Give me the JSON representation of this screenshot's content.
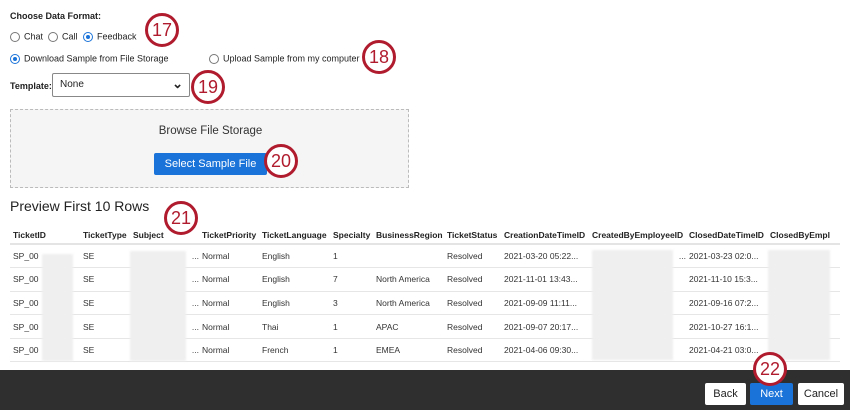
{
  "data_format": {
    "label": "Choose Data Format:",
    "options": [
      {
        "label": "Chat",
        "selected": false
      },
      {
        "label": "Call",
        "selected": false
      },
      {
        "label": "Feedback",
        "selected": true
      }
    ]
  },
  "source": {
    "options": [
      {
        "label": "Download Sample from File Storage",
        "selected": true
      },
      {
        "label": "Upload Sample from my computer",
        "selected": false
      }
    ]
  },
  "template": {
    "label": "Template:",
    "value": "None"
  },
  "browse": {
    "title": "Browse File Storage",
    "button": "Select Sample File"
  },
  "preview": {
    "title": "Preview First 10 Rows",
    "columns": [
      "TicketID",
      "TicketType",
      "Subject",
      "TicketPriority",
      "TicketLanguage",
      "Specialty",
      "BusinessRegion",
      "TicketStatus",
      "CreationDateTimeID",
      "CreatedByEmployeeID",
      "ClosedDateTimeID",
      "ClosedByEmpl"
    ],
    "rows": [
      [
        "SP_00",
        "SE",
        "...",
        "Normal",
        "English",
        "1",
        "",
        "Resolved",
        "2021-03-20 05:22...",
        "...",
        "2021-03-23 02:0...",
        ""
      ],
      [
        "SP_00",
        "SE",
        "...",
        "Normal",
        "English",
        "7",
        "North America",
        "Resolved",
        "2021-11-01 13:43...",
        "",
        "2021-11-10 15:3...",
        ""
      ],
      [
        "SP_00",
        "SE",
        "...",
        "Normal",
        "English",
        "3",
        "North America",
        "Resolved",
        "2021-09-09 11:11...",
        "",
        "2021-09-16 07:2...",
        ""
      ],
      [
        "SP_00",
        "SE",
        "...",
        "Normal",
        "Thai",
        "1",
        "APAC",
        "Resolved",
        "2021-09-07 20:17...",
        "",
        "2021-10-27 16:1...",
        ""
      ],
      [
        "SP_00",
        "SE",
        "...",
        "Normal",
        "French",
        "1",
        "EMEA",
        "Resolved",
        "2021-04-06 09:30...",
        "",
        "2021-04-21 03:0...",
        ""
      ]
    ]
  },
  "footer": {
    "back": "Back",
    "next": "Next",
    "cancel": "Cancel"
  },
  "callouts": [
    "17",
    "18",
    "19",
    "20",
    "21",
    "22"
  ]
}
